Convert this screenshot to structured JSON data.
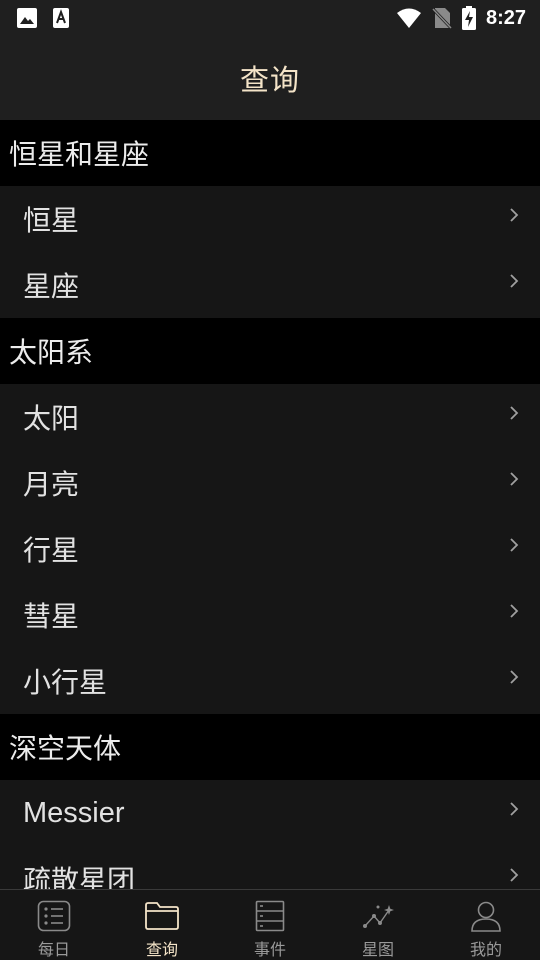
{
  "status_bar": {
    "time": "8:27",
    "left_icons": [
      "image-icon",
      "text-a-icon"
    ],
    "right_icons": [
      "wifi-icon",
      "no-sim-icon",
      "battery-charging-icon"
    ]
  },
  "header": {
    "title": "查询"
  },
  "sections": [
    {
      "title": "恒星和星座",
      "items": [
        {
          "label": "恒星"
        },
        {
          "label": "星座"
        }
      ]
    },
    {
      "title": "太阳系",
      "items": [
        {
          "label": "太阳"
        },
        {
          "label": "月亮"
        },
        {
          "label": "行星"
        },
        {
          "label": "彗星"
        },
        {
          "label": "小行星"
        }
      ]
    },
    {
      "title": "深空天体",
      "items": [
        {
          "label": "Messier"
        },
        {
          "label": "疏散星团"
        }
      ]
    }
  ],
  "bottom_nav": {
    "items": [
      {
        "label": "每日",
        "icon": "daily-list-icon",
        "active": false
      },
      {
        "label": "查询",
        "icon": "folder-icon",
        "active": true
      },
      {
        "label": "事件",
        "icon": "events-icon",
        "active": false
      },
      {
        "label": "星图",
        "icon": "star-map-icon",
        "active": false
      },
      {
        "label": "我的",
        "icon": "profile-icon",
        "active": false
      }
    ]
  },
  "colors": {
    "accent": "#f4e4c8",
    "background": "#161616",
    "section_header_bg": "#000000",
    "bar_bg": "#1f1f1f",
    "inactive_icon": "#8a8a8a"
  }
}
